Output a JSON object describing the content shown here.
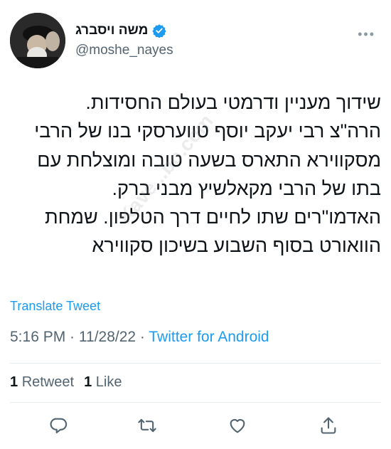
{
  "user": {
    "display_name": "משה ויסברג",
    "handle": "@moshe_nayes"
  },
  "more_label": "•••",
  "tweet_lines": [
    "שידוך מעניין ודרמטי בעולם החסידות.",
    "הרה\"צ רבי יעקב יוסף טווערסקי בנו של הרבי",
    "מסקווירא התארס בשעה טובה ומוצלחת עם",
    "בתו של הרבי מקאלשיץ מבני ברק.",
    "האדמו\"רים שתו לחיים דרך הטלפון. שמחת",
    "הוואורט בסוף השבוע בשיכון סקווירא"
  ],
  "watermark": "Kave...bo.com",
  "translate_label": "Translate Tweet",
  "meta": {
    "time": "5:16 PM",
    "date": "11/28/22",
    "sep": " · ",
    "source": "Twitter for Android"
  },
  "stats": {
    "retweets_count": "1",
    "retweets_label": "Retweet",
    "likes_count": "1",
    "likes_label": "Like"
  },
  "actions": [
    "reply-icon",
    "retweet-icon",
    "like-icon",
    "share-icon"
  ],
  "colors": {
    "accent": "#1d9bf0",
    "text": "#0f1419",
    "secondary": "#536471"
  }
}
